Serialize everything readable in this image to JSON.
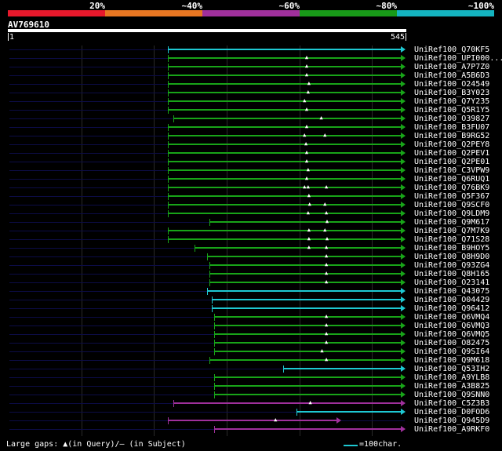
{
  "identity_scale": {
    "segments": [
      {
        "color": "#e8192c"
      },
      {
        "color": "#e87722"
      },
      {
        "color": "#a0309c"
      },
      {
        "color": "#189a18"
      },
      {
        "color": "#14b4c0"
      }
    ],
    "labels": [
      "20%",
      "~40%",
      "~60%",
      "~80%",
      "~100%"
    ]
  },
  "query": {
    "name": "AV769610",
    "start": "1",
    "end": "545"
  },
  "colors": {
    "green": "#18a418",
    "cyan": "#1ec8d2",
    "magenta": "#a0309c",
    "base": "#0c0c46"
  },
  "hits": [
    {
      "label": "UniRef100_Q70KF5",
      "start": 219,
      "end": 545,
      "color": "cyan"
    },
    {
      "label": "UniRef100_UPI000...",
      "start": 219,
      "end": 545,
      "color": "green",
      "gaps": [
        410
      ]
    },
    {
      "label": "UniRef100_A7P7Z0",
      "start": 219,
      "end": 545,
      "color": "green",
      "gaps": [
        410
      ]
    },
    {
      "label": "UniRef100_A5B6D3",
      "start": 219,
      "end": 545,
      "color": "green",
      "gaps": [
        410
      ]
    },
    {
      "label": "UniRef100_O24549",
      "start": 219,
      "end": 545,
      "color": "green",
      "gaps": [
        413
      ]
    },
    {
      "label": "UniRef100_B3Y023",
      "start": 219,
      "end": 545,
      "color": "green",
      "gaps": [
        412
      ]
    },
    {
      "label": "UniRef100_Q7Y235",
      "start": 219,
      "end": 545,
      "color": "green",
      "gaps": [
        407
      ]
    },
    {
      "label": "UniRef100_Q5R1Y5",
      "start": 219,
      "end": 545,
      "color": "green",
      "gaps": [
        410
      ]
    },
    {
      "label": "UniRef100_O39827",
      "start": 227,
      "end": 545,
      "color": "green",
      "gaps": [
        430
      ]
    },
    {
      "label": "UniRef100_B3FU07",
      "start": 219,
      "end": 545,
      "color": "green",
      "gaps": [
        410
      ]
    },
    {
      "label": "UniRef100_B9RG52",
      "start": 219,
      "end": 545,
      "color": "green",
      "gaps": [
        407,
        435
      ]
    },
    {
      "label": "UniRef100_Q2PEY8",
      "start": 219,
      "end": 545,
      "color": "green",
      "gaps": [
        409
      ]
    },
    {
      "label": "UniRef100_Q2PEV1",
      "start": 219,
      "end": 545,
      "color": "green",
      "gaps": [
        410
      ]
    },
    {
      "label": "UniRef100_Q2PE01",
      "start": 219,
      "end": 545,
      "color": "green",
      "gaps": [
        410
      ]
    },
    {
      "label": "UniRef100_C3VPW9",
      "start": 219,
      "end": 545,
      "color": "green",
      "gaps": [
        412
      ]
    },
    {
      "label": "UniRef100_Q6RUQ1",
      "start": 219,
      "end": 545,
      "color": "green",
      "gaps": [
        410
      ]
    },
    {
      "label": "UniRef100_Q76BK9",
      "start": 219,
      "end": 545,
      "color": "green",
      "gaps": [
        407,
        412,
        437
      ]
    },
    {
      "label": "UniRef100_Q5F367",
      "start": 219,
      "end": 545,
      "color": "green",
      "gaps": [
        413
      ]
    },
    {
      "label": "UniRef100_Q9SCF0",
      "start": 219,
      "end": 545,
      "color": "green",
      "gaps": [
        414,
        435
      ]
    },
    {
      "label": "UniRef100_Q9LDM9",
      "start": 219,
      "end": 545,
      "color": "green",
      "gaps": [
        412,
        437
      ]
    },
    {
      "label": "UniRef100_Q9M617",
      "start": 276,
      "end": 545,
      "color": "green",
      "gaps": [
        438
      ]
    },
    {
      "label": "UniRef100_Q7M7K9",
      "start": 219,
      "end": 545,
      "color": "green",
      "gaps": [
        413,
        435
      ]
    },
    {
      "label": "UniRef100_Q71S28",
      "start": 219,
      "end": 545,
      "color": "green",
      "gaps": [
        413,
        438
      ]
    },
    {
      "label": "UniRef100_B9HOY5",
      "start": 256,
      "end": 545,
      "color": "green",
      "gaps": [
        413,
        437
      ]
    },
    {
      "label": "UniRef100_Q8H9D0",
      "start": 273,
      "end": 545,
      "color": "green",
      "gaps": [
        437
      ]
    },
    {
      "label": "UniRef100_Q93ZG4",
      "start": 276,
      "end": 545,
      "color": "green",
      "gaps": [
        437
      ]
    },
    {
      "label": "UniRef100_Q8H165",
      "start": 276,
      "end": 545,
      "color": "green",
      "gaps": [
        437
      ]
    },
    {
      "label": "UniRef100_O23141",
      "start": 276,
      "end": 545,
      "color": "green",
      "gaps": [
        437
      ]
    },
    {
      "label": "UniRef100_Q43075",
      "start": 273,
      "end": 545,
      "color": "cyan"
    },
    {
      "label": "UniRef100_O04429",
      "start": 279,
      "end": 545,
      "color": "cyan"
    },
    {
      "label": "UniRef100_Q96412",
      "start": 279,
      "end": 545,
      "color": "cyan"
    },
    {
      "label": "UniRef100_Q6VMQ4",
      "start": 283,
      "end": 545,
      "color": "green",
      "gaps": [
        437
      ]
    },
    {
      "label": "UniRef100_Q6VMQ3",
      "start": 283,
      "end": 545,
      "color": "green",
      "gaps": [
        437
      ]
    },
    {
      "label": "UniRef100_Q6VMQ5",
      "start": 283,
      "end": 545,
      "color": "green",
      "gaps": [
        437
      ]
    },
    {
      "label": "UniRef100_O82475",
      "start": 283,
      "end": 545,
      "color": "green",
      "gaps": [
        437
      ]
    },
    {
      "label": "UniRef100_Q9SI64",
      "start": 283,
      "end": 545,
      "color": "green",
      "gaps": [
        431
      ]
    },
    {
      "label": "UniRef100_Q9M618",
      "start": 276,
      "end": 545,
      "color": "green",
      "gaps": [
        437
      ]
    },
    {
      "label": "UniRef100_Q53IH2",
      "start": 378,
      "end": 545,
      "color": "cyan"
    },
    {
      "label": "UniRef100_A9YLB8",
      "start": 283,
      "end": 545,
      "color": "green"
    },
    {
      "label": "UniRef100_A3B825",
      "start": 283,
      "end": 545,
      "color": "green"
    },
    {
      "label": "UniRef100_Q9SNN0",
      "start": 283,
      "end": 545,
      "color": "green"
    },
    {
      "label": "UniRef100_C5Z3B3",
      "start": 227,
      "end": 545,
      "color": "magenta",
      "gaps": [
        415
      ]
    },
    {
      "label": "UniRef100_D0FOD6",
      "start": 396,
      "end": 545,
      "color": "cyan"
    },
    {
      "label": "UniRef100_Q945D9",
      "start": 219,
      "end": 456,
      "color": "magenta",
      "gaps": [
        367
      ]
    },
    {
      "label": "UniRef100_A9RKF0",
      "start": 283,
      "end": 545,
      "color": "magenta"
    }
  ],
  "legend": {
    "gaps_text": "Large gaps: ▲(in Query)/– (in Subject)",
    "key_text": "=100char."
  }
}
